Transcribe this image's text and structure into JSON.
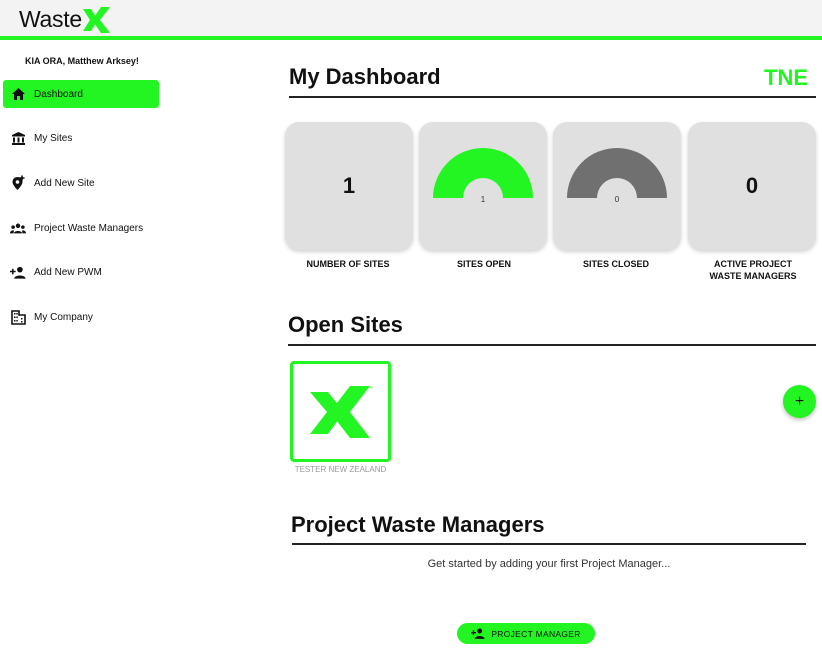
{
  "brand": {
    "logo_text": "Waste",
    "accent": "#22f522"
  },
  "sidebar": {
    "greeting": "KIA ORA, Matthew Arksey!",
    "items": [
      {
        "label": "Dashboard",
        "icon": "home-icon",
        "active": true
      },
      {
        "label": "My Sites",
        "icon": "bank-icon",
        "active": false
      },
      {
        "label": "Add New Site",
        "icon": "add-location-icon",
        "active": false
      },
      {
        "label": "Project Waste Managers",
        "icon": "group-icon",
        "active": false
      },
      {
        "label": "Add New PWM",
        "icon": "person-add-icon",
        "active": false
      },
      {
        "label": "My Company",
        "icon": "building-icon",
        "active": false
      }
    ]
  },
  "dashboard": {
    "title": "My Dashboard",
    "company_code": "TNE",
    "stats": [
      {
        "label": "NUMBER OF SITES",
        "value": "1",
        "kind": "number"
      },
      {
        "label": "SITES OPEN",
        "value": "1",
        "kind": "gauge",
        "color": "#22f522"
      },
      {
        "label": "SITES CLOSED",
        "value": "0",
        "kind": "gauge",
        "color": "#707070"
      },
      {
        "label": "ACTIVE PROJECT WASTE MANAGERS",
        "value": "0",
        "kind": "number"
      }
    ]
  },
  "open_sites": {
    "title": "Open Sites",
    "sites": [
      {
        "name": "TESTER NEW ZEALAND",
        "icon": "company-x-logo-icon"
      }
    ],
    "add_button": "+"
  },
  "pwm": {
    "title": "Project Waste Managers",
    "empty_text": "Get started by adding your first Project Manager...",
    "button_label": "PROJECT MANAGER",
    "button_icon": "person-add-icon"
  }
}
